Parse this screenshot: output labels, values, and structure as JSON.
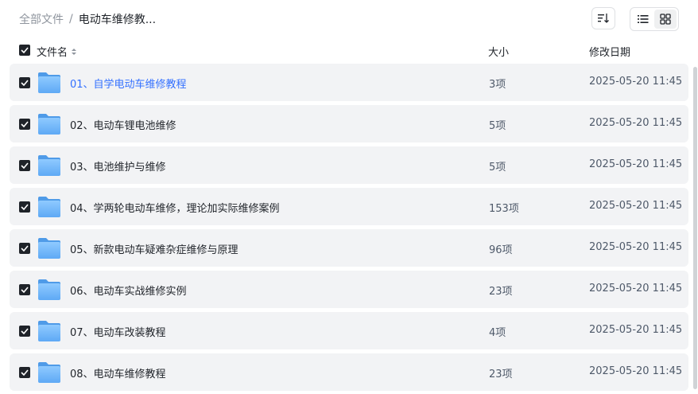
{
  "breadcrumb": {
    "root": "全部文件",
    "separator": "/",
    "current": "电动车维修教..."
  },
  "toolbar": {
    "sort_icon": "sort-icon",
    "list_view_icon": "list-view-icon",
    "grid_view_icon": "grid-view-icon"
  },
  "header": {
    "name": "文件名",
    "size": "大小",
    "modified": "修改日期"
  },
  "colors": {
    "link": "#3370ff",
    "row_bg": "#f2f3f5",
    "checkbox": "#1f2329"
  },
  "rows": [
    {
      "name": "01、自学电动车维修教程",
      "size": "3项",
      "date": "2025-05-20 11:45"
    },
    {
      "name": "02、电动车锂电池维修",
      "size": "5项",
      "date": "2025-05-20 11:45"
    },
    {
      "name": "03、电池维护与维修",
      "size": "5项",
      "date": "2025-05-20 11:45"
    },
    {
      "name": "04、学两轮电动车维修，理论加实际维修案例",
      "size": "153项",
      "date": "2025-05-20 11:45"
    },
    {
      "name": "05、新款电动车疑难杂症维修与原理",
      "size": "96项",
      "date": "2025-05-20 11:45"
    },
    {
      "name": "06、电动车实战维修实例",
      "size": "23项",
      "date": "2025-05-20 11:45"
    },
    {
      "name": "07、电动车改装教程",
      "size": "4项",
      "date": "2025-05-20 11:45"
    },
    {
      "name": "08、电动车维修教程",
      "size": "23项",
      "date": "2025-05-20 11:45"
    }
  ]
}
